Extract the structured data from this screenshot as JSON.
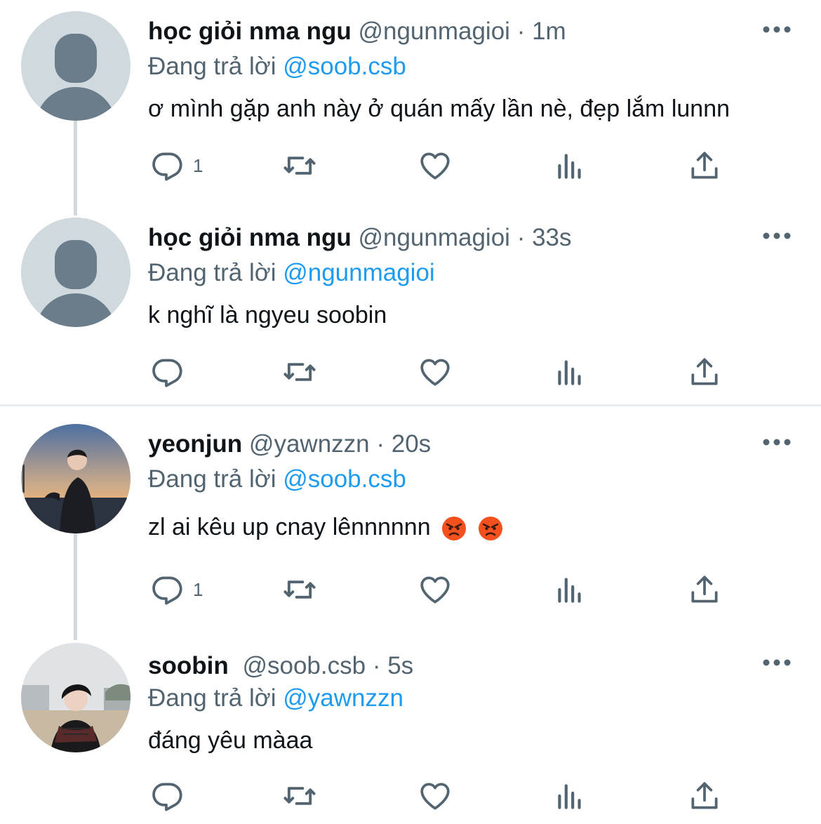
{
  "colors": {
    "text": "#0f1419",
    "muted": "#536471",
    "link": "#1d9bf0",
    "line": "#cfd9de",
    "divider": "#e6ecf0"
  },
  "tweets": [
    {
      "name": "học giỏi nma ngu",
      "handle": "@ngunmagioi",
      "time": "· 1m",
      "reply_prefix": "Đang trả lời",
      "reply_to": "@soob.csb",
      "text": "ơ mình gặp anh này ở quán mấy lần nè, đẹp lắm lunnn",
      "reply_count": "1",
      "avatar": "default-avatar"
    },
    {
      "name": "học giỏi nma ngu",
      "handle": "@ngunmagioi",
      "time": "· 33s",
      "reply_prefix": "Đang trả lời",
      "reply_to": "@ngunmagioi",
      "text": "k nghĩ là ngyeu soobin",
      "reply_count": "",
      "avatar": "default-avatar"
    },
    {
      "name": "yeonjun",
      "handle": "@yawnzzn",
      "time": "· 20s",
      "reply_prefix": "Đang trả lời",
      "reply_to": "@soob.csb",
      "text": "zl ai kêu up cnay lênnnnnn",
      "reply_count": "1",
      "avatar": "photo-avatar",
      "emojis": [
        "angry-face-emoji",
        "angry-face-emoji"
      ]
    },
    {
      "name": "soobin",
      "handle": "@soob.csb",
      "time": "· 5s",
      "reply_prefix": "Đang trả lời",
      "reply_to": "@yawnzzn",
      "text": "đáng yêu màaa",
      "reply_count": "",
      "avatar": "photo-avatar"
    }
  ]
}
